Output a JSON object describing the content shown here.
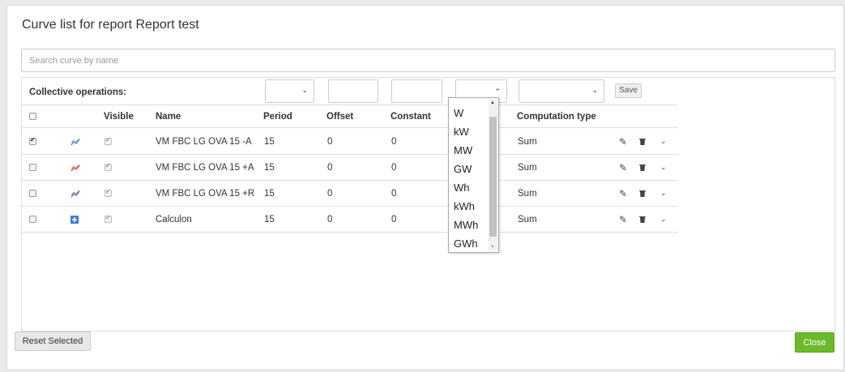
{
  "title": "Curve list for report Report test",
  "search": {
    "placeholder": "Search curve by name"
  },
  "collective": {
    "label": "Collective operations:",
    "save_label": "Save"
  },
  "columns": {
    "visible": "Visible",
    "name": "Name",
    "period": "Period",
    "offset": "Offset",
    "constant": "Constant",
    "computation": "Computation type"
  },
  "rows": [
    {
      "selected": true,
      "icon": "line-chart-icon",
      "icon_color": "#3a6fc4",
      "visible": true,
      "name": "VM FBC LG OVA 15 -A",
      "period": "15",
      "offset": "0",
      "constant": "0",
      "computation": "Sum"
    },
    {
      "selected": false,
      "icon": "line-chart-icon",
      "icon_color": "#c43a3a",
      "visible": true,
      "name": "VM FBC LG OVA 15 +A",
      "period": "15",
      "offset": "0",
      "constant": "0",
      "computation": "Sum"
    },
    {
      "selected": false,
      "icon": "line-chart-icon",
      "icon_color": "#4a5a8a",
      "visible": true,
      "name": "VM FBC LG OVA 15 +R",
      "period": "15",
      "offset": "0",
      "constant": "0",
      "computation": "Sum"
    },
    {
      "selected": false,
      "icon": "plus-square-icon",
      "icon_color": "#3a7fd5",
      "visible": true,
      "name": "Calculon",
      "period": "15",
      "offset": "0",
      "constant": "0",
      "computation": "Sum"
    }
  ],
  "unit_dropdown": {
    "options": [
      "W",
      "kW",
      "MW",
      "GW",
      "Wh",
      "kWh",
      "MWh",
      "GWh"
    ]
  },
  "footer": {
    "reset_label": "Reset Selected",
    "close_label": "Close"
  }
}
